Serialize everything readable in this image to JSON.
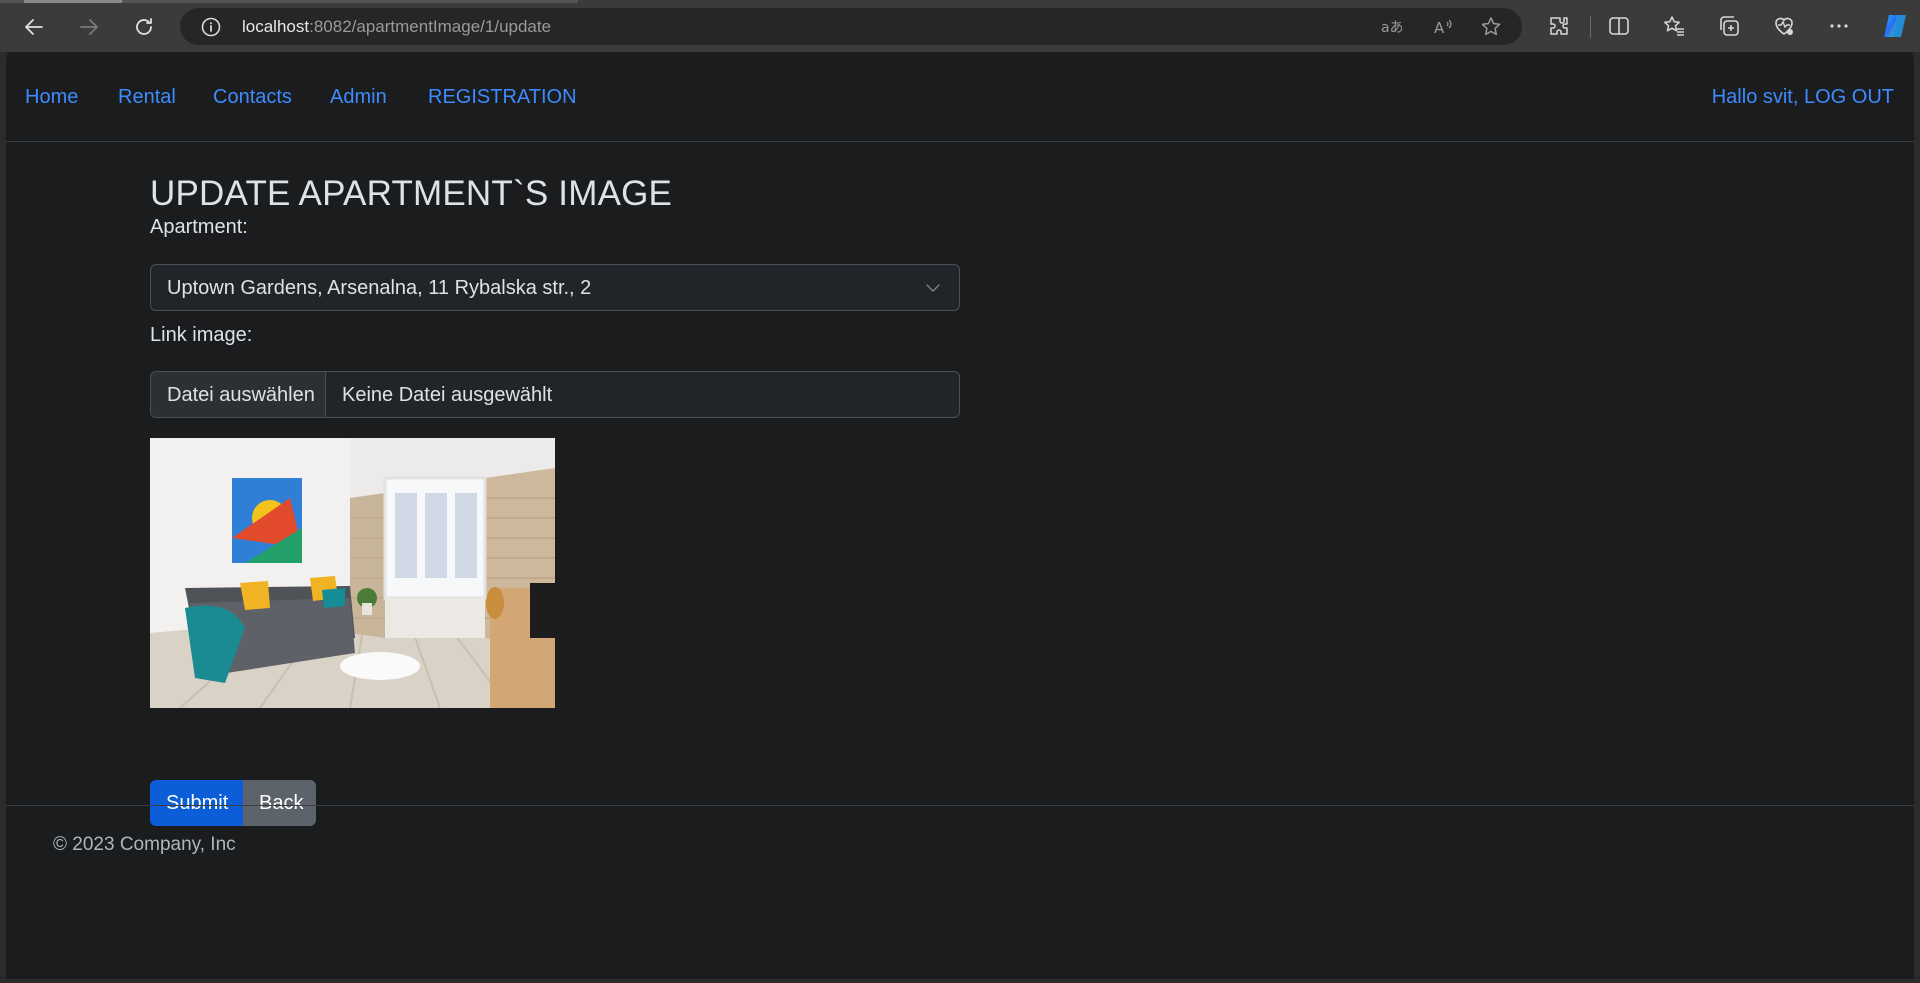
{
  "browser": {
    "url_host": "localhost",
    "url_path": ":8082/apartmentImage/1/update"
  },
  "nav": {
    "links": [
      "Home",
      "Rental",
      "Contacts",
      "Admin",
      "REGISTRATION"
    ],
    "greeting": "Hallo svit, LOG OUT"
  },
  "page": {
    "title": "UPDATE APARTMENT`S IMAGE",
    "apartment_label": "Apartment:",
    "apartment_value": "Uptown Gardens, Arsenalna, 11 Rybalska str., 2",
    "link_label": "Link image:",
    "file_button": "Datei auswählen",
    "file_status": "Keine Datei ausgewählt",
    "submit_label": "Submit",
    "back_label": "Back"
  },
  "footer": {
    "copyright": "© 2023 Company, Inc"
  },
  "colors": {
    "link": "#3d8bfd",
    "page_bg": "#1b1c1e",
    "primary": "#0b5ed7",
    "secondary": "#5c636a"
  }
}
